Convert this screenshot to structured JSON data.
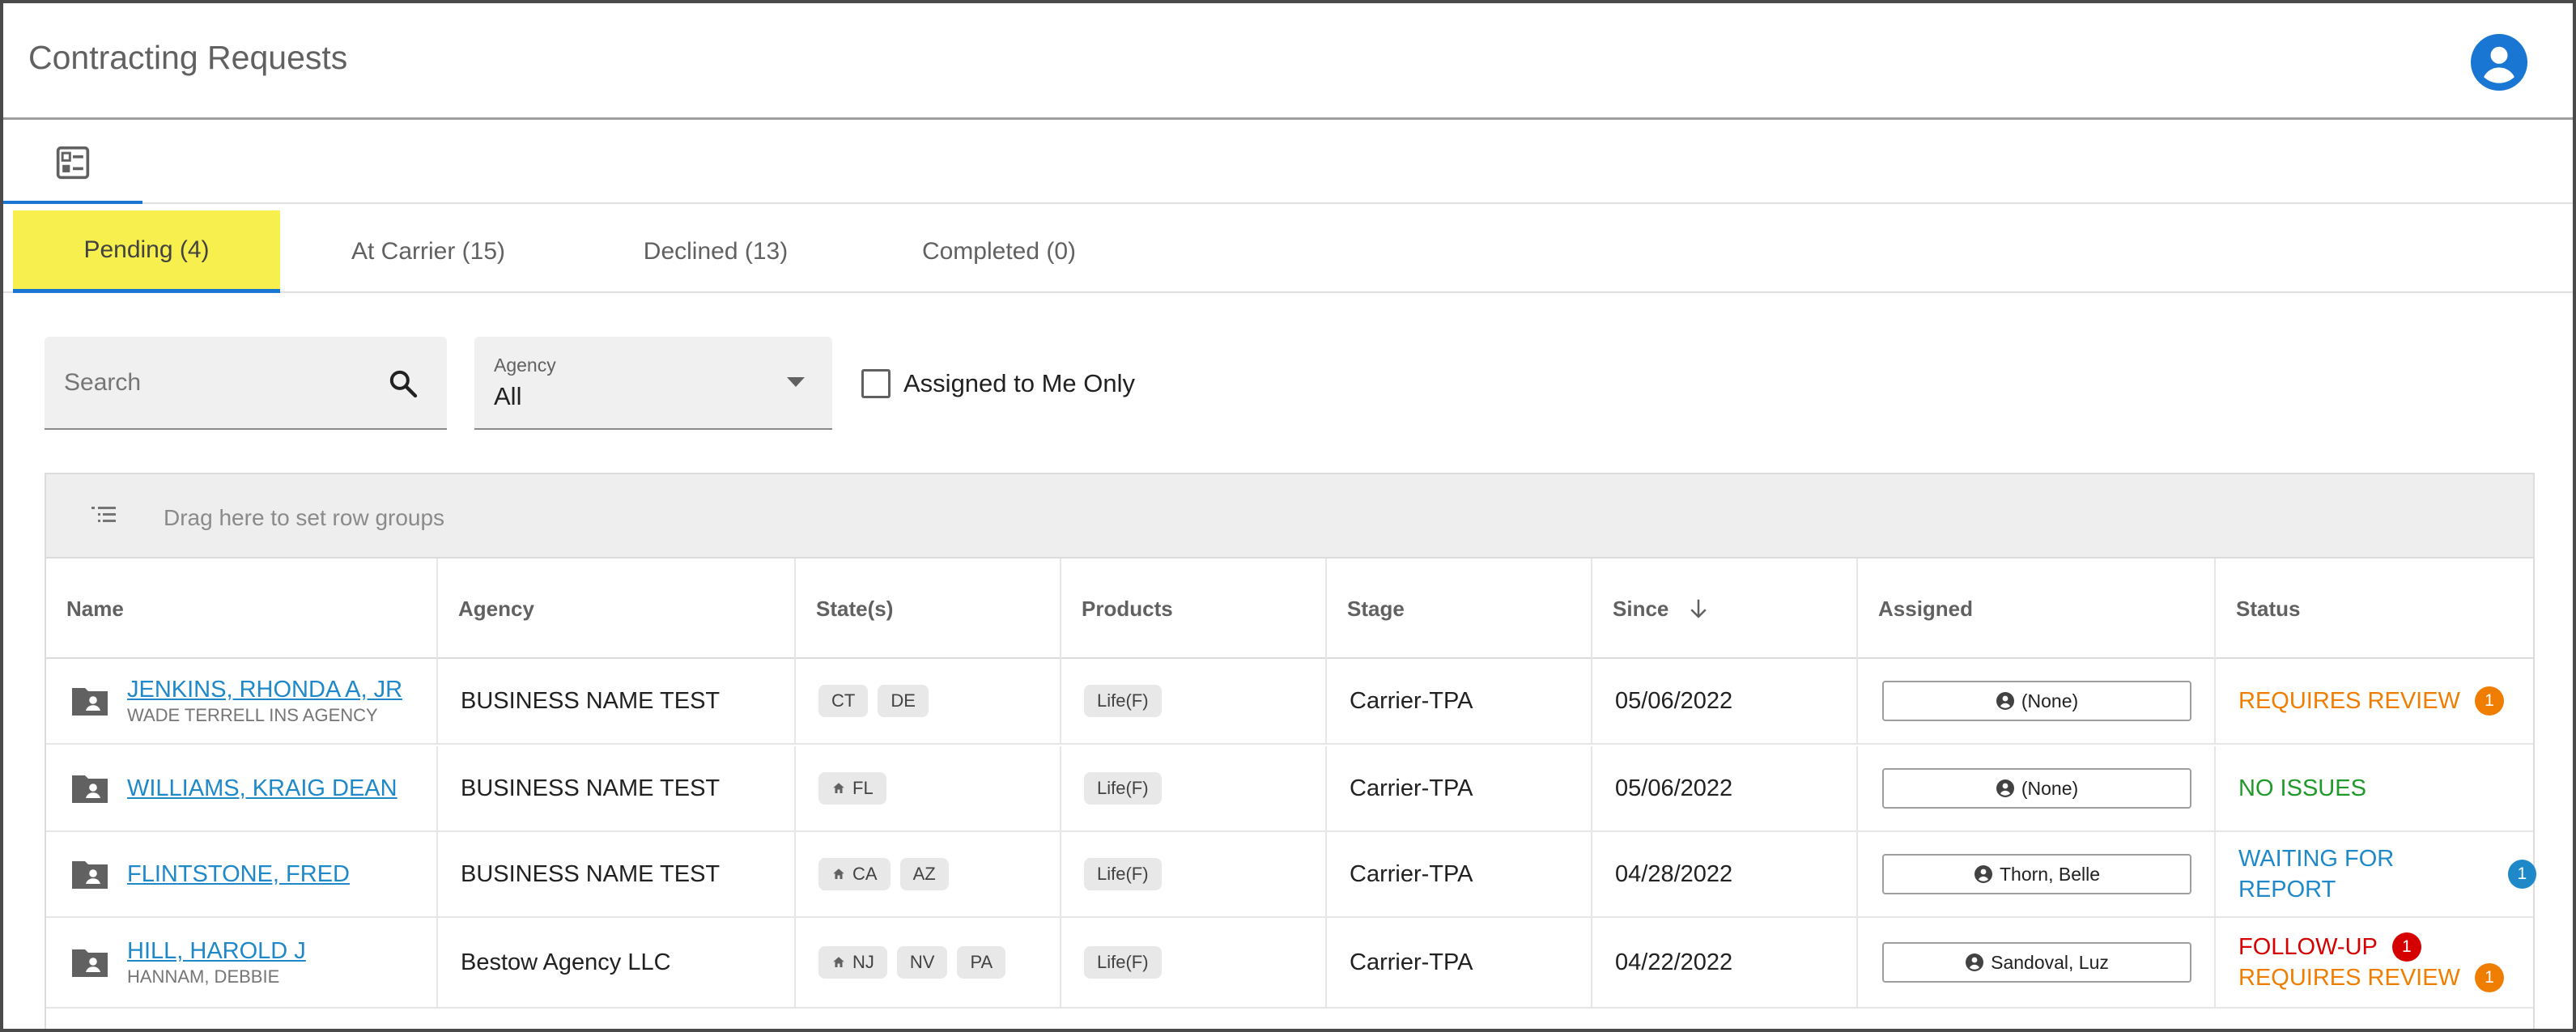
{
  "app": {
    "title": "Contracting Requests"
  },
  "tabs": [
    {
      "label": "Pending (4)",
      "active": true
    },
    {
      "label": "At Carrier (15)"
    },
    {
      "label": "Declined (13)"
    },
    {
      "label": "Completed (0)"
    }
  ],
  "filters": {
    "search_placeholder": "Search",
    "agency_label": "Agency",
    "agency_value": "All",
    "assigned_only_label": "Assigned to Me Only",
    "assigned_only_checked": false
  },
  "grid": {
    "group_hint": "Drag here to set row groups",
    "columns": [
      "Name",
      "Agency",
      "State(s)",
      "Products",
      "Stage",
      "Since",
      "Assigned",
      "Status"
    ],
    "sort": {
      "column": "Since",
      "direction": "desc"
    },
    "rows": [
      {
        "name": "JENKINS, RHONDA A, JR",
        "sub": "WADE TERRELL INS AGENCY",
        "agency": "BUSINESS NAME TEST",
        "states": [
          {
            "code": "CT",
            "home": false
          },
          {
            "code": "DE",
            "home": false
          }
        ],
        "product": "Life(F)",
        "stage": "Carrier-TPA",
        "since": "05/06/2022",
        "assigned": "(None)",
        "status": [
          {
            "text": "REQUIRES REVIEW",
            "color": "#ef7d00",
            "count": "1",
            "badge_color": "#ef7d00"
          }
        ]
      },
      {
        "name": "WILLIAMS, KRAIG DEAN",
        "sub": "",
        "agency": "BUSINESS NAME TEST",
        "states": [
          {
            "code": "FL",
            "home": true
          }
        ],
        "product": "Life(F)",
        "stage": "Carrier-TPA",
        "since": "05/06/2022",
        "assigned": "(None)",
        "status": [
          {
            "text": "NO ISSUES",
            "color": "#1f9a2a",
            "count": "",
            "badge_color": ""
          }
        ]
      },
      {
        "name": "FLINTSTONE, FRED",
        "sub": "",
        "agency": "BUSINESS NAME TEST",
        "states": [
          {
            "code": "CA",
            "home": true
          },
          {
            "code": "AZ",
            "home": false
          }
        ],
        "product": "Life(F)",
        "stage": "Carrier-TPA",
        "since": "04/28/2022",
        "assigned": "Thorn, Belle",
        "status": [
          {
            "text": "WAITING FOR REPORT",
            "color": "#1e88c9",
            "count": "1",
            "badge_color": "#1e88c9"
          }
        ]
      },
      {
        "name": "HILL, HAROLD J",
        "sub": "HANNAM, DEBBIE",
        "agency": "Bestow Agency LLC",
        "states": [
          {
            "code": "NJ",
            "home": true
          },
          {
            "code": "NV",
            "home": false
          },
          {
            "code": "PA",
            "home": false
          }
        ],
        "product": "Life(F)",
        "stage": "Carrier-TPA",
        "since": "04/22/2022",
        "assigned": "Sandoval, Luz",
        "status": [
          {
            "text": "FOLLOW-UP",
            "color": "#d50000",
            "count": "1",
            "badge_color": "#d50000"
          },
          {
            "text": "REQUIRES REVIEW",
            "color": "#ef7d00",
            "count": "1",
            "badge_color": "#ef7d00"
          }
        ]
      }
    ]
  },
  "colors": {
    "accent": "#1976d2",
    "tab_highlight": "#f7ef4e",
    "link": "#1e88c9"
  },
  "icons": {
    "account": "account-circle-icon",
    "view": "list-view-icon",
    "search": "search-icon",
    "caret": "caret-down-icon",
    "group": "row-group-icon",
    "sort": "arrow-down-icon",
    "folder": "folder-person-icon",
    "home": "home-icon",
    "person": "person-icon"
  }
}
